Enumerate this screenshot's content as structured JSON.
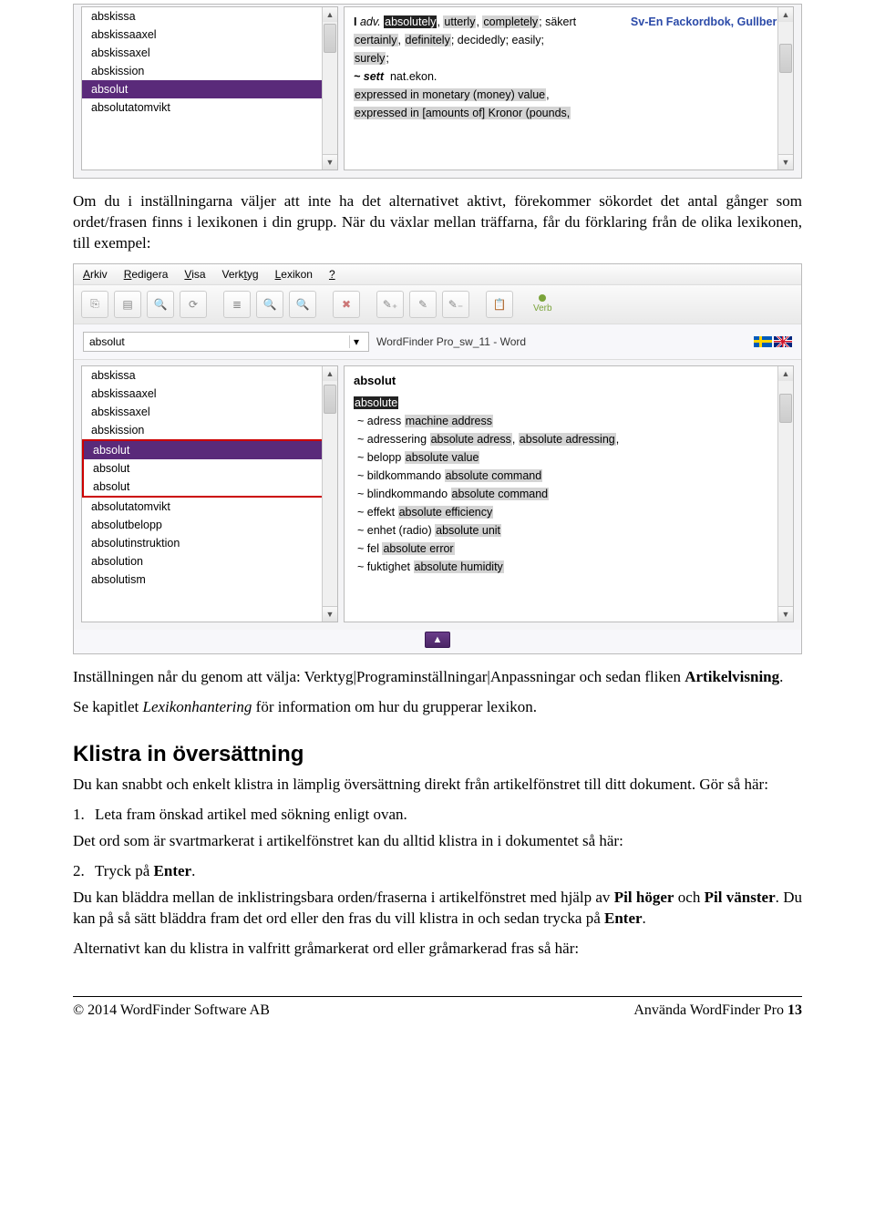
{
  "app1": {
    "left_list": [
      "abskissa",
      "abskissaaxel",
      "abskissaxel",
      "abskission",
      "absolut",
      "absolutatomvikt"
    ],
    "left_selected_index": 4,
    "right_header_source": "Sv-En Fackordbok, Gullberg",
    "right_pos": "I",
    "right_pos_label": "adv.",
    "right_line1_terms": [
      "absolutely",
      "utterly",
      "completely"
    ],
    "right_line1_tail": "; säkert",
    "right_line2_terms": [
      "certainly",
      "definitely"
    ],
    "right_line2_tail": "; decidedly; easily;",
    "right_line3_terms": [
      "surely"
    ],
    "right_line3_tail": ";",
    "right_sett": "~ sett",
    "right_sett_tag": "nat.ekon.",
    "right_mon1": "expressed in monetary (money) value",
    "right_mon2": "expressed in [amounts of] Kronor (pounds,"
  },
  "doc": {
    "p1": "Om du i inställningarna väljer att inte ha det alternativet aktivt, förekommer sökordet det antal gånger som ordet/frasen finns i lexikonen i din grupp. När du växlar mellan träffarna, får du förklaring från de olika lexikonen, till exempel:",
    "p2a": "Inställningen når du genom att välja: Verktyg|Programinställningar|Anpassningar och sedan fliken ",
    "p2b_bold": "Artikelvisning",
    "p2c": ".",
    "p3a": "Se kapitlet ",
    "p3b_em": "Lexikonhantering",
    "p3c": " för information om hur du grupperar lexikon.",
    "h2": "Klistra in översättning",
    "p4": "Du kan snabbt och enkelt klistra in lämplig översättning direkt från artikelfönstret till ditt dokument. Gör så här:",
    "n1": "1.",
    "n1t": "Leta fram önskad artikel med sökning enligt ovan.",
    "p5": "Det ord som är svartmarkerat i artikelfönstret kan du alltid klistra in i dokumentet så här:",
    "n2": "2.",
    "n2t_a": "Tryck på ",
    "n2t_b": "Enter",
    "n2t_c": ".",
    "p6a": "Du kan bläddra mellan de inklistringsbara orden/fraserna i artikelfönstret med hjälp av ",
    "p6b": "Pil höger",
    "p6c": " och ",
    "p6d": "Pil vänster",
    "p6e": ". Du kan på så sätt bläddra fram det ord eller den fras du vill klistra in och sedan trycka på ",
    "p6f": "Enter",
    "p6g": ".",
    "p7": "Alternativt kan du klistra in valfritt gråmarkerat ord eller gråmarkerad fras så här:"
  },
  "app2": {
    "menus": [
      "Arkiv",
      "Redigera",
      "Visa",
      "Verktyg",
      "Lexikon",
      "?"
    ],
    "verb_label": "Verb",
    "search_value": "absolut",
    "dict_label": "WordFinder Pro_sw_11 - Word",
    "left_list": [
      "abskissa",
      "abskissaaxel",
      "abskissaxel",
      "abskission",
      "absolut",
      "absolut",
      "absolut",
      "absolutatomvikt",
      "absolutbelopp",
      "absolutinstruktion",
      "absolution",
      "absolutism"
    ],
    "left_selected_index": 4,
    "redbox_from": 4,
    "redbox_to": 6,
    "right_head": "absolut",
    "right_sel": "absolute",
    "right_rows": [
      {
        "sw": "~ adress",
        "en": "machine address"
      },
      {
        "sw": "~ adressering",
        "en_multi": [
          "absolute adress",
          "absolute adressing"
        ],
        "trail": ","
      },
      {
        "sw": "~ belopp",
        "en": "absolute value"
      },
      {
        "sw": "~ bildkommando",
        "en": "absolute command"
      },
      {
        "sw": "~ blindkommando",
        "en": "absolute command"
      },
      {
        "sw": "~ effekt",
        "en": "absolute efficiency"
      },
      {
        "sw": "~ enhet (radio)",
        "en": "absolute unit"
      },
      {
        "sw": "~ fel",
        "en": "absolute error"
      },
      {
        "sw": "~ fuktighet",
        "en": "absolute humidity"
      }
    ]
  },
  "footer": {
    "left": "© 2014 WordFinder Software AB",
    "right_a": "Använda WordFinder Pro ",
    "right_b": "13"
  }
}
